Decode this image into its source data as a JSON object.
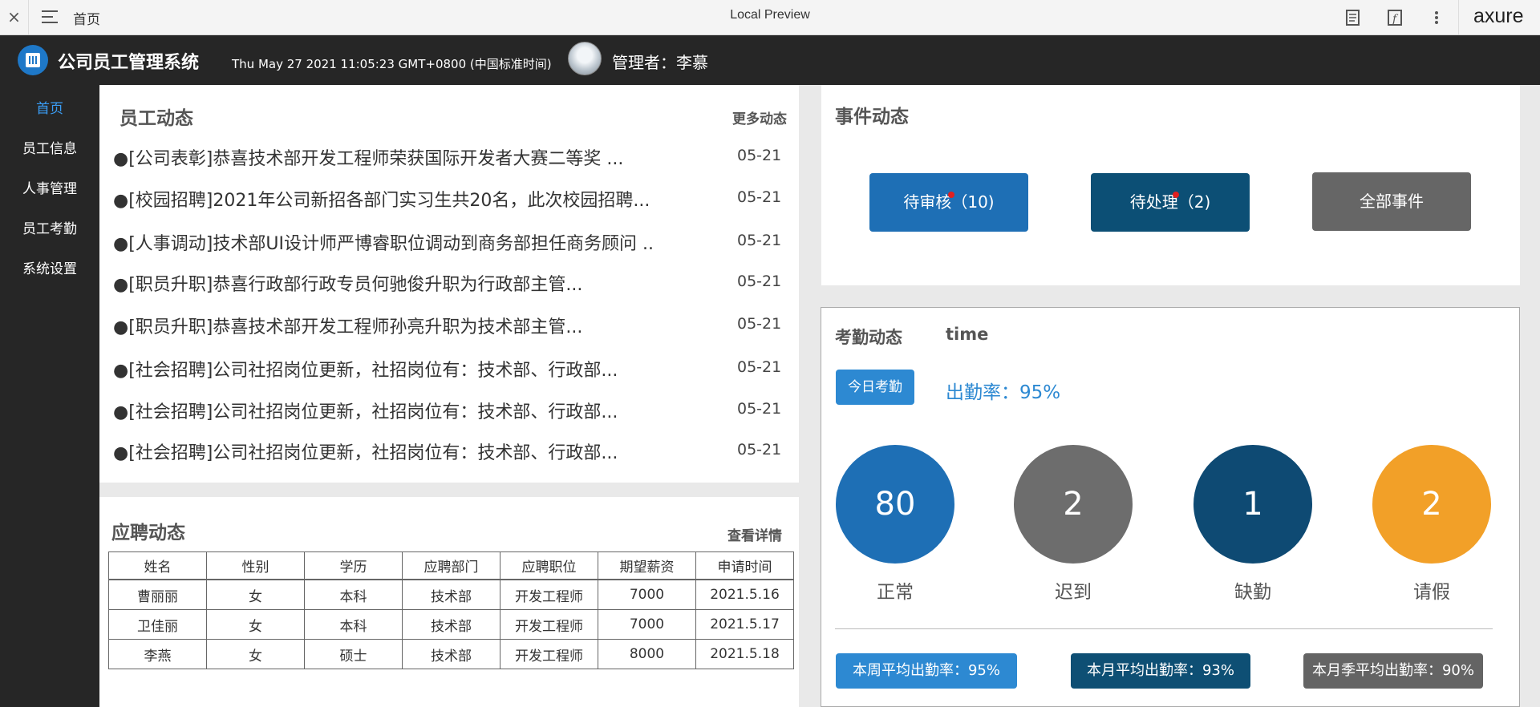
{
  "preview_bar": {
    "close": "×",
    "page_name": "首页",
    "title": "Local Preview",
    "logo": "axure"
  },
  "header": {
    "system_title": "公司员工管理系统",
    "datetime": "Thu May 27 2021 11:05:23 GMT+0800 (中国标准时间)",
    "admin": "管理者：李慕"
  },
  "sidebar": {
    "items": [
      "首页",
      "员工信息",
      "人事管理",
      "员工考勤",
      "系统设置"
    ],
    "active_index": 0
  },
  "news": {
    "title": "员工动态",
    "more": "更多动态",
    "items": [
      {
        "text": "●[公司表彰]恭喜技术部开发工程师荣获国际开发者大赛二等奖 ...",
        "date": "05-21"
      },
      {
        "text": "●[校园招聘]2021年公司新招各部门实习生共20名，此次校园招聘...",
        "date": "05-21"
      },
      {
        "text": "●[人事调动]技术部UI设计师严博睿职位调动到商务部担任商务顾问 ..",
        "date": "05-21"
      },
      {
        "text": "●[职员升职]恭喜行政部行政专员何驰俊升职为行政部主管...",
        "date": "05-21"
      },
      {
        "text": "●[职员升职]恭喜技术部开发工程师孙亮升职为技术部主管...",
        "date": "05-21"
      },
      {
        "text": "●[社会招聘]公司社招岗位更新，社招岗位有：技术部、行政部...",
        "date": "05-21"
      },
      {
        "text": "●[社会招聘]公司社招岗位更新，社招岗位有：技术部、行政部...",
        "date": "05-21"
      },
      {
        "text": "●[社会招聘]公司社招岗位更新，社招岗位有：技术部、行政部...",
        "date": "05-21"
      }
    ]
  },
  "recruit": {
    "title": "应聘动态",
    "more": "查看详情",
    "columns": [
      "姓名",
      "性别",
      "学历",
      "应聘部门",
      "应聘职位",
      "期望薪资",
      "申请时间"
    ],
    "rows": [
      [
        "曹丽丽",
        "女",
        "本科",
        "技术部",
        "开发工程师",
        "7000",
        "2021.5.16"
      ],
      [
        "卫佳丽",
        "女",
        "本科",
        "技术部",
        "开发工程师",
        "7000",
        "2021.5.17"
      ],
      [
        "李燕",
        "女",
        "硕士",
        "技术部",
        "开发工程师",
        "8000",
        "2021.5.18"
      ]
    ]
  },
  "events": {
    "title": "事件动态",
    "buttons": [
      {
        "label": "待审核（10)",
        "color": "#1e6fb5"
      },
      {
        "label": "待处理（2)",
        "color": "#0c4f75"
      },
      {
        "label": "全部事件",
        "color": "#666666"
      }
    ]
  },
  "attendance": {
    "title": "考勤动态",
    "time_label": "time",
    "today_button": "今日考勤",
    "rate": "出勤率：95%",
    "stats": [
      {
        "value": "80",
        "label": "正常",
        "color": "#1e6fb5"
      },
      {
        "value": "2",
        "label": "迟到",
        "color": "#6d6d6d"
      },
      {
        "value": "1",
        "label": "缺勤",
        "color": "#0e4a73"
      },
      {
        "value": "2",
        "label": "请假",
        "color": "#f2a028"
      }
    ],
    "rates": [
      {
        "label": "本周平均出勤率：95%",
        "color": "#2d89d2"
      },
      {
        "label": "本月平均出勤率：93%",
        "color": "#0e4f74"
      },
      {
        "label": "本月季平均出勤率：90%",
        "color": "#646464"
      }
    ]
  }
}
